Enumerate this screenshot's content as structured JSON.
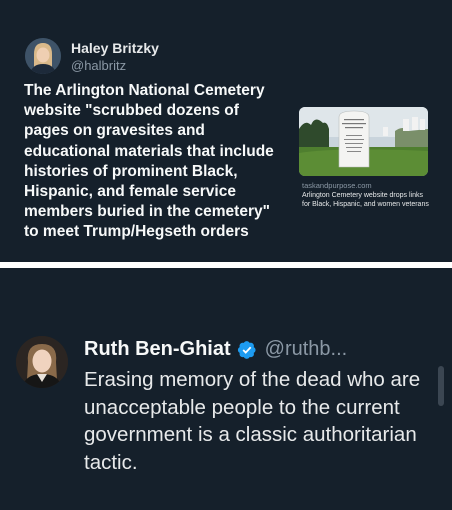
{
  "post1": {
    "author_name": "Haley Britzky",
    "author_handle": "@halbritz",
    "text": "The Arlington National Cemetery website \"scrubbed dozens of pages on gravesites and educational materials that include histories of prominent Black, Hispanic, and female service members buried in the cemetery\" to meet Trump/Hegseth orders",
    "link_card": {
      "domain": "taskandpurpose.com",
      "title": "Arlington Cemetery website drops links for Black, Hispanic, and women veterans"
    }
  },
  "post2": {
    "author_name": "Ruth Ben-Ghiat",
    "author_handle": "@ruthb...",
    "verified_icon": "verified-badge-icon",
    "text": "Erasing memory of the dead who are unacceptable people to the current government is a classic authoritarian tactic."
  },
  "colors": {
    "background": "#15202b",
    "divider": "#ffffff",
    "muted_text": "#8b98a5",
    "verified_blue": "#1d9bf0"
  }
}
